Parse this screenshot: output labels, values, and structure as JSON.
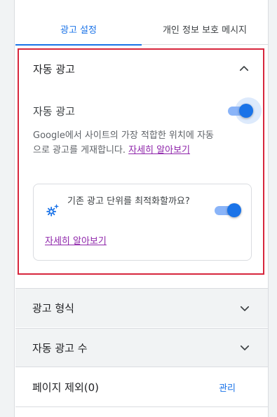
{
  "tabs": [
    {
      "label": "광고 설정",
      "active": true
    },
    {
      "label": "개인 정보 보호 메시지",
      "active": false
    }
  ],
  "auto_ads": {
    "section_title": "자동 광고",
    "expanded": true,
    "toggle_label": "자동 광고",
    "toggle_on": true,
    "description": "Google에서 사이트의 가장 적합한 위치에 자동으로 광고를 게재합니다. ",
    "learn_more": "자세히 알아보기",
    "optimize_card": {
      "icon": "sparkle-gear-icon",
      "text": "기존 광고 단위를 최적화할까요?",
      "toggle_on": true,
      "learn_more": "자세히 알아보기"
    }
  },
  "ad_formats": {
    "title": "광고 형식",
    "expanded": false
  },
  "ad_load": {
    "title": "자동 광고 수",
    "expanded": false
  },
  "page_exclusions": {
    "title": "페이지 제외(0)",
    "action": "관리"
  },
  "colors": {
    "accent": "#1a73e8",
    "highlight_border": "#d7263d",
    "link": "#8e24aa"
  }
}
